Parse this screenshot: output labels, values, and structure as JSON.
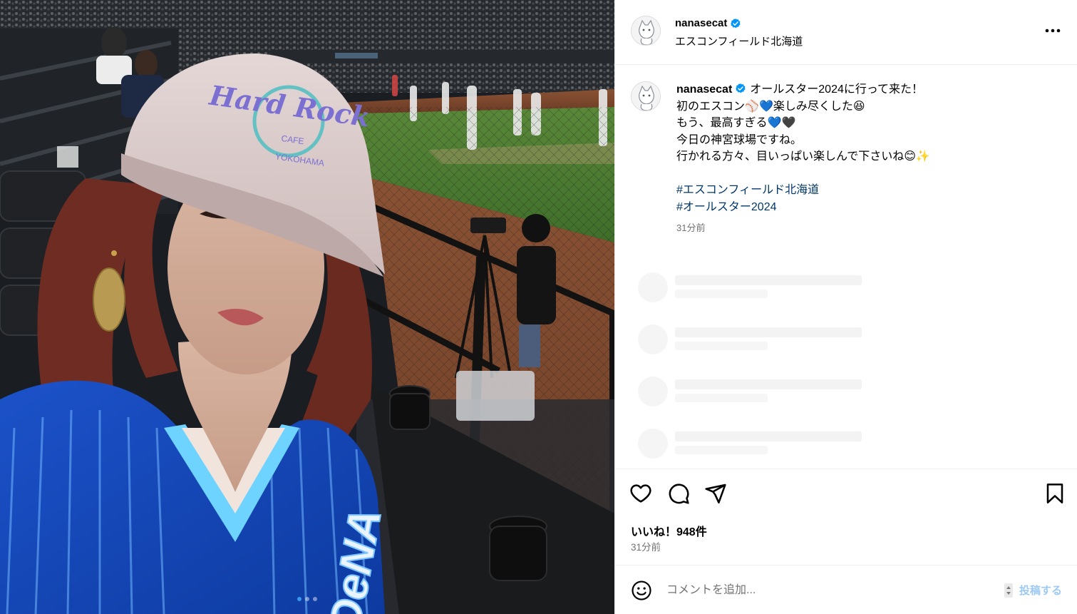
{
  "photo": {
    "alt_icon": "stadium-selfie-photo",
    "cap_text": "Hard Rock",
    "cap_sub": "CAFE",
    "cap_city": "YOKOHAMA",
    "jersey_text": "DeNA",
    "carousel": {
      "count": 3,
      "active_index": 0
    }
  },
  "header": {
    "username": "nanasecat",
    "location": "エスコンフィールド北海道",
    "more_icon": "more-options-icon"
  },
  "caption": {
    "username": "nanasecat",
    "lines": [
      "オールスター2024に行って来た！",
      "初のエスコン⚾",
      "楽しみ尽くした😆",
      "もう、最高すぎる",
      "今日の神宮球場ですね。",
      "行かれる方々、目いっぱい楽しんで下さいね😊✨"
    ],
    "hearts": [
      "💙",
      "💙",
      "🖤"
    ],
    "hashtags": [
      "#エスコンフィールド北海道",
      "#オールスター2024"
    ],
    "time": "31分前"
  },
  "actions": {
    "like_icon": "heart-icon",
    "comment_icon": "comment-icon",
    "share_icon": "share-icon",
    "save_icon": "bookmark-icon",
    "likes_text": "いいね！948件",
    "time": "31分前"
  },
  "comment": {
    "emoji_icon": "emoji-icon",
    "placeholder": "コメントを追加...",
    "post_label": "投稿する"
  },
  "colors": {
    "link": "#00376b",
    "verified": "#0095f6",
    "muted": "#737373",
    "post_disabled": "#9ec9f2"
  }
}
